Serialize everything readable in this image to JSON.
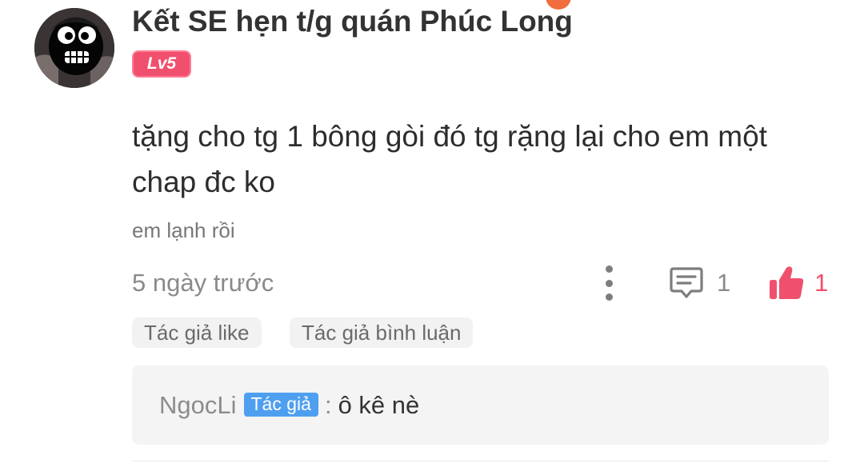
{
  "comment": {
    "username": "Kết SE hẹn t/g quán Phúc Long",
    "level_badge": "Lv5",
    "text": "tặng cho tg 1 bông gòi đó tg rặng lại cho em một chap đc ko",
    "subtitle": "em lạnh rồi",
    "timestamp": "5 ngày trước",
    "reply_count": "1",
    "like_count": "1"
  },
  "tags": {
    "author_like": "Tác giả like",
    "author_comment": "Tác giả bình luận"
  },
  "reply": {
    "author": "NgocLi",
    "author_badge": "Tác giả",
    "separator": ":",
    "message": "ô kê nè"
  },
  "icons": {
    "avatar": "avatar-image",
    "more": "more-vertical-icon",
    "reply": "comment-icon",
    "like": "thumbs-up-icon"
  },
  "colors": {
    "level_badge": "#f0506e",
    "like": "#f0506e",
    "author_badge": "#4f9ff0",
    "accent_dot": "#f26d3d"
  }
}
